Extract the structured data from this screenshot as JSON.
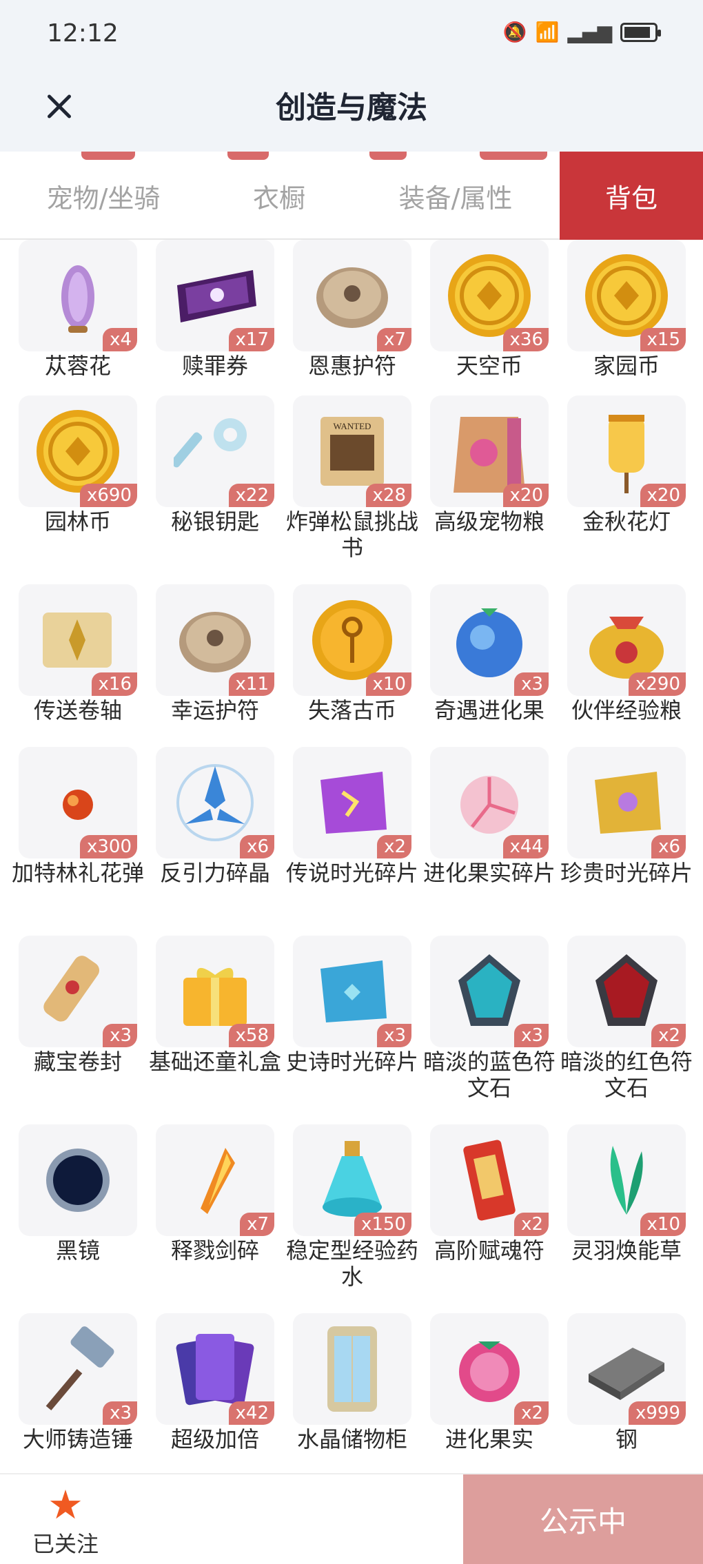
{
  "status_bar": {
    "time": "12:12"
  },
  "header": {
    "title": "创造与魔法"
  },
  "tabs": [
    {
      "label": "宠物/坐骑"
    },
    {
      "label": "衣橱"
    },
    {
      "label": "装备/属性"
    },
    {
      "label": "背包"
    }
  ],
  "selected_tab": "背包",
  "items": [
    {
      "name": "苁蓉花",
      "qty": "x4",
      "icon": "purple-flower-icon"
    },
    {
      "name": "赎罪券",
      "qty": "x17",
      "icon": "ticket-icon"
    },
    {
      "name": "恩惠护符",
      "qty": "x7",
      "icon": "stone-amulet-icon"
    },
    {
      "name": "天空币",
      "qty": "x36",
      "icon": "gold-coin-icon"
    },
    {
      "name": "家园币",
      "qty": "x15",
      "icon": "gold-coin-icon"
    },
    {
      "name": "园林币",
      "qty": "x690",
      "icon": "gold-coin-icon"
    },
    {
      "name": "秘银钥匙",
      "qty": "x22",
      "icon": "key-icon"
    },
    {
      "name": "炸弹松鼠挑战书",
      "qty": "x28",
      "icon": "wanted-poster-icon"
    },
    {
      "name": "高级宠物粮",
      "qty": "x20",
      "icon": "pet-food-bag-icon"
    },
    {
      "name": "金秋花灯",
      "qty": "x20",
      "icon": "lantern-icon"
    },
    {
      "name": "传送卷轴",
      "qty": "x16",
      "icon": "scroll-icon"
    },
    {
      "name": "幸运护符",
      "qty": "x11",
      "icon": "stone-amulet-icon"
    },
    {
      "name": "失落古币",
      "qty": "x10",
      "icon": "ankh-coin-icon"
    },
    {
      "name": "奇遇进化果",
      "qty": "x3",
      "icon": "blue-fruit-icon"
    },
    {
      "name": "伙伴经验粮",
      "qty": "x290",
      "icon": "gold-pouch-icon"
    },
    {
      "name": "加特林礼花弹",
      "qty": "x300",
      "icon": "firework-icon"
    },
    {
      "name": "反引力碎晶",
      "qty": "x6",
      "icon": "crystal-shard-icon"
    },
    {
      "name": "传说时光碎片",
      "qty": "x2",
      "icon": "purple-puzzle-icon"
    },
    {
      "name": "进化果实碎片",
      "qty": "x44",
      "icon": "fruit-slice-icon"
    },
    {
      "name": "珍贵时光碎片",
      "qty": "x6",
      "icon": "gold-puzzle-icon"
    },
    {
      "name": "藏宝卷封",
      "qty": "x3",
      "icon": "treasure-scroll-icon"
    },
    {
      "name": "基础还童礼盒",
      "qty": "x58",
      "icon": "gift-box-icon"
    },
    {
      "name": "史诗时光碎片",
      "qty": "x3",
      "icon": "blue-puzzle-icon"
    },
    {
      "name": "暗淡的蓝色符文石",
      "qty": "x3",
      "icon": "blue-rune-stone-icon"
    },
    {
      "name": "暗淡的红色符文石",
      "qty": "x2",
      "icon": "red-rune-stone-icon"
    },
    {
      "name": "黑镜",
      "qty": "",
      "icon": "black-mirror-icon"
    },
    {
      "name": "释戮剑碎",
      "qty": "x7",
      "icon": "sword-shard-icon"
    },
    {
      "name": "稳定型经验药水",
      "qty": "x150",
      "icon": "potion-icon"
    },
    {
      "name": "高阶赋魂符",
      "qty": "x2",
      "icon": "talisman-icon"
    },
    {
      "name": "灵羽焕能草",
      "qty": "x10",
      "icon": "green-herb-icon"
    },
    {
      "name": "大师铸造锤",
      "qty": "x3",
      "icon": "hammer-icon"
    },
    {
      "name": "超级加倍",
      "qty": "x42",
      "icon": "cards-icon"
    },
    {
      "name": "水晶储物柜",
      "qty": "",
      "icon": "cabinet-icon"
    },
    {
      "name": "进化果实",
      "qty": "x2",
      "icon": "raspberry-fruit-icon"
    },
    {
      "name": "钢",
      "qty": "x999",
      "icon": "steel-ingot-icon"
    }
  ],
  "bottom_bar": {
    "follow_label": "已关注",
    "announce_label": "公示中"
  },
  "colors": {
    "accent": "#c9363a",
    "qty_badge": "#d9736e",
    "announce_bg": "#dd9e9c",
    "star": "#f05a22"
  }
}
